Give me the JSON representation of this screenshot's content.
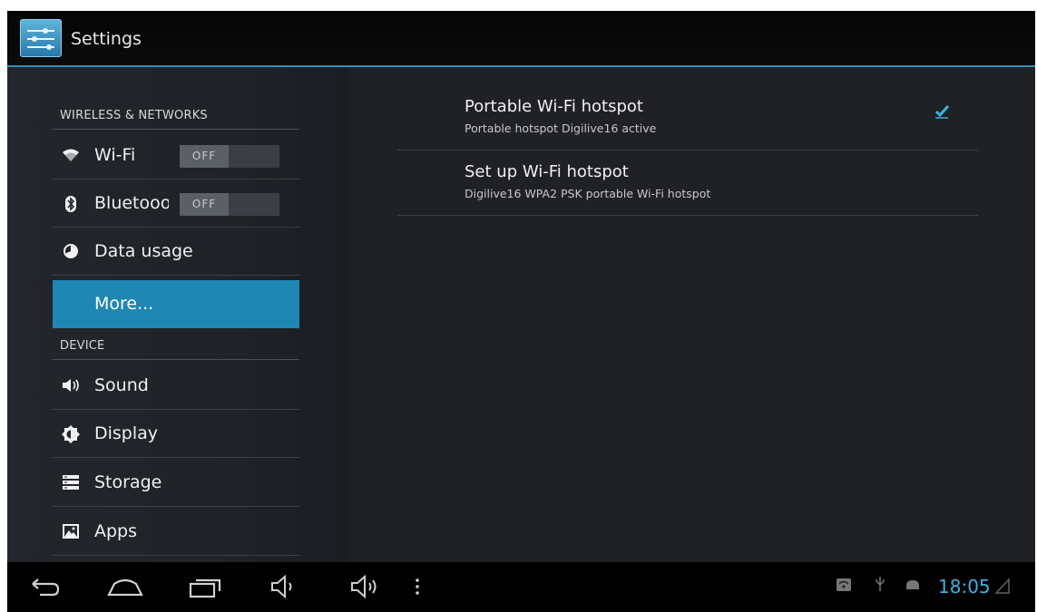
{
  "app": {
    "title": "Settings"
  },
  "sidebar": {
    "sections": [
      {
        "header": "WIRELESS & NETWORKS"
      },
      {
        "header": "DEVICE"
      }
    ],
    "items": [
      {
        "label": "Wi-Fi",
        "toggle": "OFF",
        "icon": "wifi-icon"
      },
      {
        "label": "Bluetooot",
        "toggle": "OFF",
        "icon": "bluetooth-icon"
      },
      {
        "label": "Data usage",
        "icon": "data-usage-icon"
      },
      {
        "label": "More...",
        "selected": true
      },
      {
        "label": "Sound",
        "icon": "sound-icon"
      },
      {
        "label": "Display",
        "icon": "display-icon"
      },
      {
        "label": "Storage",
        "icon": "storage-icon"
      },
      {
        "label": "Apps",
        "icon": "apps-icon"
      }
    ]
  },
  "detail": {
    "prefs": [
      {
        "title": "Portable Wi-Fi hotspot",
        "summary": "Portable hotspot Digilive16 active",
        "checked": true
      },
      {
        "title": "Set up Wi-Fi hotspot",
        "summary": "Digilive16 WPA2 PSK portable Wi-Fi hotspot"
      }
    ]
  },
  "navbar": {
    "buttons": [
      "back-icon",
      "home-icon",
      "recent-apps-icon",
      "volume-down-icon",
      "volume-up-icon",
      "menu-icon"
    ],
    "status_icons": [
      "hotspot-icon",
      "usb-icon",
      "android-debug-icon"
    ],
    "clock": "18:05",
    "accent": "#33b5e5"
  },
  "colors": {
    "selected": "#1f87b3",
    "divider": "#2f8fb6"
  }
}
